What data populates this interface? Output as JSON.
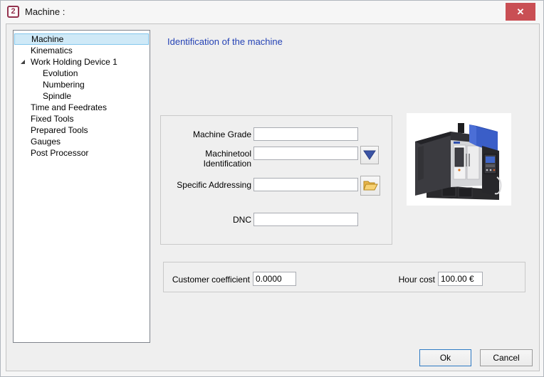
{
  "window": {
    "title": "Machine :",
    "app_icon_glyph": "2",
    "close_glyph": "✕"
  },
  "tree": {
    "items": [
      {
        "label": "Machine",
        "level": 1,
        "selected": true
      },
      {
        "label": "Kinematics",
        "level": 1
      },
      {
        "label": "Work Holding Device 1",
        "level": 1,
        "expanded": true
      },
      {
        "label": "Evolution",
        "level": 2
      },
      {
        "label": "Numbering",
        "level": 2
      },
      {
        "label": "Spindle",
        "level": 2
      },
      {
        "label": "Time and Feedrates",
        "level": 1
      },
      {
        "label": "Fixed Tools",
        "level": 1
      },
      {
        "label": "Prepared Tools",
        "level": 1
      },
      {
        "label": "Gauges",
        "level": 1
      },
      {
        "label": "Post Processor",
        "level": 1
      }
    ]
  },
  "main": {
    "heading": "Identification of the machine",
    "identification": {
      "machine_grade": {
        "label": "Machine Grade",
        "value": ""
      },
      "machinetool_identification": {
        "label": "Machinetool Identification",
        "value": ""
      },
      "specific_addressing": {
        "label": "Specific Addressing",
        "value": ""
      },
      "dnc": {
        "label": "DNC",
        "value": ""
      }
    },
    "photo": "cnc-machining-center",
    "costs": {
      "customer_coefficient": {
        "label": "Customer coefficient",
        "value": "0.0000"
      },
      "hour_cost": {
        "label": "Hour cost",
        "value": "100.00 €"
      }
    }
  },
  "footer": {
    "ok": "Ok",
    "cancel": "Cancel"
  },
  "colors": {
    "close_button": "#c94f54",
    "heading_text": "#2442b5",
    "selection_fill": "#cfe9f7",
    "selection_border": "#84c7ec",
    "dropdown_arrow": "#3b54a5",
    "folder_yellow": "#f5c842",
    "machine_blue": "#3a5ec8"
  }
}
